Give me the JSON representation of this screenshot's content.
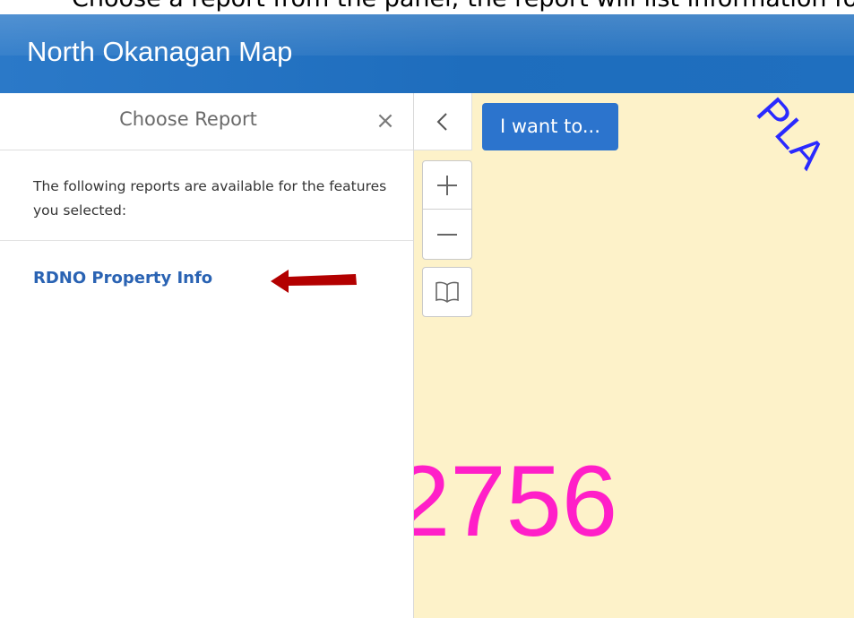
{
  "caption": {
    "text": "Choose a report from the panel; the report will list information for the property"
  },
  "header": {
    "title": "North Okanagan Map"
  },
  "panel": {
    "title": "Choose Report",
    "close_icon": "×",
    "intro": "The following reports are available for the features you selected:",
    "reports": [
      {
        "label": "RDNO Property Info"
      }
    ]
  },
  "map": {
    "toggle_icon": "chevron-left-icon",
    "want_button": "I want to...",
    "zoom_in_icon": "plus-icon",
    "zoom_out_icon": "minus-icon",
    "bookmark_icon": "book-icon",
    "label_number": "2756",
    "label_road": "PLA"
  },
  "colors": {
    "header": "#1e6dbd",
    "button": "#2c74cd",
    "link": "#2a63b3",
    "arrow": "#b30000",
    "map_bg": "#fdf2c9",
    "map_number": "#ff1fc8",
    "map_road": "#2a2aff"
  }
}
